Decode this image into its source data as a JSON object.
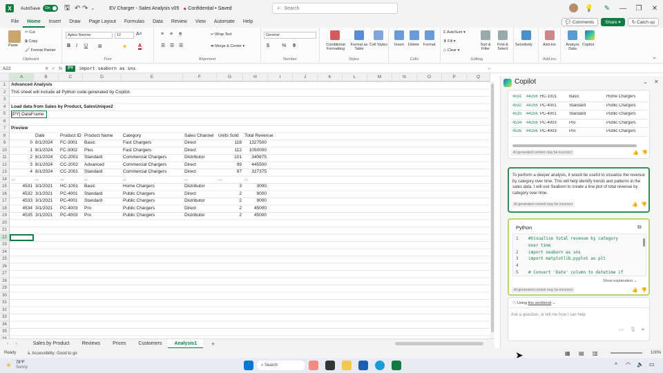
{
  "titlebar": {
    "autosave_label": "AutoSave",
    "autosave_state": "On",
    "title": "EV Charger - Sales Analysis v05",
    "sensitivity": "Confidential",
    "save_status": "Saved",
    "search_placeholder": "Search"
  },
  "menu": {
    "items": [
      "File",
      "Home",
      "Insert",
      "Draw",
      "Page Layout",
      "Formulas",
      "Data",
      "Review",
      "View",
      "Automate",
      "Help"
    ],
    "active": "Home",
    "comments_label": "Comments",
    "share_label": "Share",
    "catchup_label": "Catch up"
  },
  "ribbon": {
    "clipboard": {
      "paste": "Paste",
      "cut": "Cut",
      "copy": "Copy",
      "format_painter": "Format Painter",
      "label": "Clipboard"
    },
    "font": {
      "font_name": "Aptos Narrow",
      "font_size": "12",
      "label": "Font",
      "bold": "B",
      "italic": "I",
      "underline": "U",
      "font_color": "A"
    },
    "alignment": {
      "wrap_text": "Wrap Text",
      "merge_center": "Merge & Center",
      "label": "Alignment"
    },
    "number": {
      "format": "General",
      "label": "Number",
      "currency": "$",
      "percent": "%",
      "comma": "9"
    },
    "styles": {
      "conditional": "Conditional Formatting",
      "format_table": "Format as Table",
      "cell_styles": "Cell Styles",
      "label": "Styles"
    },
    "cells": {
      "insert": "Insert",
      "delete": "Delete",
      "format": "Format",
      "label": "Cells"
    },
    "editing": {
      "autosum": "AutoSum",
      "fill": "Fill",
      "clear": "Clear",
      "sort_filter": "Sort & Filter",
      "find_select": "Find & Select",
      "label": "Editing"
    },
    "sensitivity": {
      "label": "Sensitivity"
    },
    "addins": {
      "addins": "Add-ins",
      "label": "Add-ins"
    },
    "analyze": {
      "analyze_data": "Analyze Data",
      "copilot": "Copilot"
    }
  },
  "formula": {
    "cell_ref": "A22",
    "fx": "fx",
    "py": "PY",
    "content": "import seaborn as sns"
  },
  "grid": {
    "columns": [
      "A",
      "B",
      "C",
      "D",
      "E",
      "F",
      "G",
      "H",
      "I",
      "J",
      "K",
      "L",
      "M",
      "N",
      "O",
      "P",
      "Q"
    ],
    "rows": [
      "1",
      "2",
      "3",
      "4",
      "5",
      "6",
      "7",
      "8",
      "9",
      "10",
      "11",
      "12",
      "13",
      "14",
      "15",
      "16",
      "17",
      "18",
      "19",
      "20",
      "21",
      "22",
      "23",
      "24",
      "25",
      "26",
      "27",
      "28",
      "29",
      "30",
      "31",
      "32",
      "33",
      "34",
      "35",
      "36"
    ],
    "a1": "Advanced Analysis",
    "a2": "This sheet will include all Python code generated by Copilot.",
    "a4": "Load data from Sales by Product, SalesUnique2",
    "a5": "[PY] DataFrame",
    "a7": "Preview",
    "headers": [
      "",
      "Date",
      "Product ID",
      "Product Name",
      "Category",
      "Sales Channel",
      "Units Sold",
      "Total Revenue"
    ],
    "data": [
      [
        "0",
        "8/1/2024",
        "FC-3001",
        "Basic",
        "Fast Chargers",
        "Direct",
        "118",
        "1327500"
      ],
      [
        "1",
        "8/1/2024",
        "FC-3002",
        "Plus",
        "Fast Chargers",
        "Direct",
        "112",
        "1050000"
      ],
      [
        "2",
        "8/1/2024",
        "CC-2001",
        "Standard",
        "Commercial Chargers",
        "Distributor",
        "101",
        "340875"
      ],
      [
        "3",
        "8/1/2024",
        "CC-2002",
        "Advanced",
        "Commercial Chargers",
        "Direct",
        "99",
        "445500"
      ],
      [
        "4",
        "8/1/2024",
        "CC-2001",
        "Standard",
        "Commercial Chargers",
        "Direct",
        "97",
        "327375"
      ],
      [
        "...",
        "...",
        "...",
        "...",
        "...",
        "...",
        "...",
        "..."
      ],
      [
        "4531",
        "3/1/2021",
        "HC-1001",
        "Basic",
        "Home Chargers",
        "Distributor",
        "3",
        "3000"
      ],
      [
        "4532",
        "3/1/2021",
        "PC-4001",
        "Standard",
        "Public Chargers",
        "Direct",
        "2",
        "9000"
      ],
      [
        "4533",
        "3/1/2021",
        "PC-4001",
        "Standard",
        "Public Chargers",
        "Distributor",
        "2",
        "9000"
      ],
      [
        "4534",
        "3/1/2021",
        "PC-4003",
        "Pro",
        "Public Chargers",
        "Direct",
        "2",
        "45000"
      ],
      [
        "4535",
        "3/1/2021",
        "PC-4003",
        "Pro",
        "Public Chargers",
        "Distributor",
        "2",
        "45000"
      ]
    ]
  },
  "sheets": {
    "tabs": [
      "Sales by Product",
      "Reviews",
      "Prices",
      "Customers",
      "Analysis1"
    ],
    "active": "Analysis1"
  },
  "status": {
    "ready": "Ready",
    "accessibility": "Accessibility: Good to go",
    "zoom": "100%"
  },
  "copilot": {
    "title": "Copilot",
    "preview_rows": [
      [
        "4531",
        "44256",
        "HC-1001",
        "Basic",
        "Home Chargers"
      ],
      [
        "4532",
        "44256",
        "PC-4001",
        "Standard",
        "Public Chargers"
      ],
      [
        "4533",
        "44256",
        "PC-4001",
        "Standard",
        "Public Chargers"
      ],
      [
        "4534",
        "44256",
        "PC-4003",
        "Pro",
        "Public Chargers"
      ],
      [
        "4535",
        "44256",
        "PC-4003",
        "Pro",
        "Public Chargers"
      ]
    ],
    "ai_note": "AI-generated content may be incorrect",
    "message": "To perform a deeper analysis, it would be useful to visualize the revenue by category over time. This will help identify trends and patterns in the sales data. I will use Seaborn to create a line plot of total revenue by category over time.",
    "code_title": "Python",
    "code_lines": [
      "#Visualize total revenue by category",
      "over time",
      "import seaborn as sns",
      "import matplotlib.pyplot as plt",
      "",
      "# Convert 'Date' column to datetime if"
    ],
    "code_line_numbers": [
      "1",
      "",
      "2",
      "3",
      "4",
      "5"
    ],
    "show_explanation": "Show explanation",
    "using_label": "Using",
    "using_link": "this workbook",
    "ask_placeholder": "Ask a question, or tell me how I can help"
  },
  "taskbar": {
    "weather_temp": "78°F",
    "weather_text": "Sunny",
    "search": "Search"
  }
}
